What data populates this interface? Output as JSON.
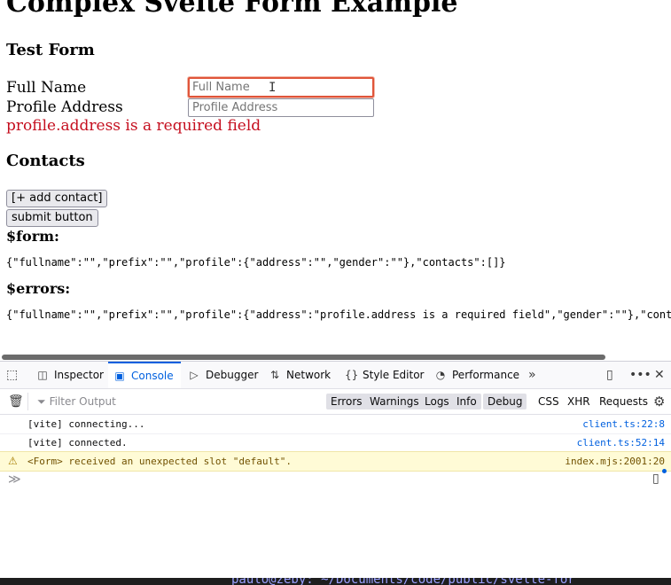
{
  "page": {
    "title": "Complex Svelte Form Example",
    "form_heading": "Test Form",
    "fullname_label": "Full Name",
    "fullname_placeholder": "Full Name",
    "address_label": "Profile Address",
    "address_placeholder": "Profile Address",
    "address_error": "profile.address is a required field",
    "contacts_heading": "Contacts",
    "add_contact_label": "[+ add contact]",
    "submit_label": "submit button",
    "form_heading_state": "$form:",
    "form_json": "{\"fullname\":\"\",\"prefix\":\"\",\"profile\":{\"address\":\"\",\"gender\":\"\"},\"contacts\":[]}",
    "errors_heading": "$errors:",
    "errors_json": "{\"fullname\":\"\",\"prefix\":\"\",\"profile\":{\"address\":\"profile.address is a required field\",\"gender\":\"\"},\"cont"
  },
  "devtools": {
    "tabs": [
      {
        "label": "Inspector",
        "icon": "inspector-icon"
      },
      {
        "label": "Console",
        "icon": "console-icon"
      },
      {
        "label": "Debugger",
        "icon": "debugger-icon"
      },
      {
        "label": "Network",
        "icon": "network-icon"
      },
      {
        "label": "Style Editor",
        "icon": "style-editor-icon"
      },
      {
        "label": "Performance",
        "icon": "performance-icon"
      }
    ],
    "active_tab": "Console",
    "filter_placeholder": "Filter Output",
    "levels": [
      "Errors",
      "Warnings",
      "Logs",
      "Info",
      "Debug"
    ],
    "types": [
      "CSS",
      "XHR",
      "Requests"
    ],
    "messages": [
      {
        "text": "[vite] connecting...",
        "source": "client.ts:22:8",
        "level": "log"
      },
      {
        "text": "[vite] connected.",
        "source": "client.ts:52:14",
        "level": "log"
      },
      {
        "text": "<Form> received an unexpected slot \"default\".",
        "source": "index.mjs:2001:20",
        "level": "warning"
      }
    ],
    "colors": {
      "accent": "#0060df",
      "warning_bg": "#fffbd6",
      "error_text": "#c50f1f"
    }
  },
  "terminal": {
    "prompt": "paulo@zeby: ~/Documents/code/public/svelte-for"
  }
}
